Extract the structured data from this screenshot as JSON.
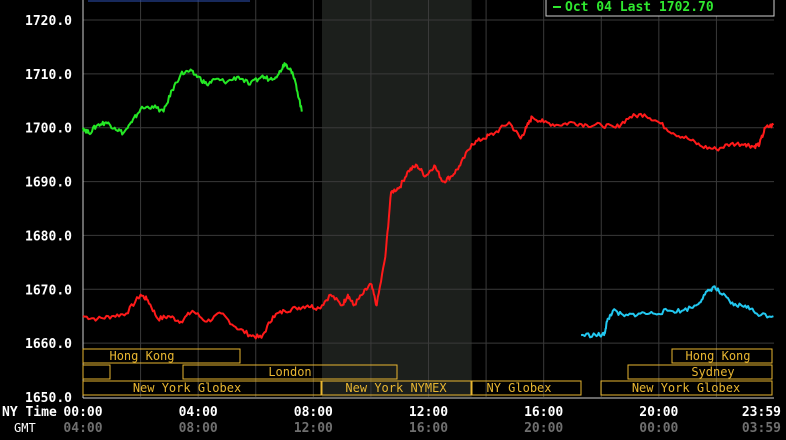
{
  "chart_data": {
    "type": "line",
    "legend": "Oct 04 Last 1702.70",
    "ylim": [
      1650,
      1720
    ],
    "yticks": [
      "1650.0",
      "1660.0",
      "1670.0",
      "1680.0",
      "1690.0",
      "1700.0",
      "1710.0",
      "1720.0"
    ],
    "x_ny_label": "NY Time",
    "x_gmt_label": "GMT",
    "xticks_ny": [
      "00:00",
      "04:00",
      "08:00",
      "12:00",
      "16:00",
      "20:00",
      "23:59"
    ],
    "xticks_gmt": [
      "04:00",
      "08:00",
      "12:00",
      "16:00",
      "20:00",
      "00:00",
      "03:59"
    ],
    "xtick_hours": [
      0,
      4,
      8,
      12,
      16,
      20,
      23.98
    ],
    "shaded_hours": [
      8.3,
      13.5
    ],
    "sessions": {
      "row1": [
        "Hong Kong",
        "Hong Kong"
      ],
      "row2": [
        "London",
        "Sydney"
      ],
      "row3": [
        "New York Globex",
        "New York NYMEX",
        "NY Globex",
        "New York Globex"
      ]
    },
    "series": [
      {
        "color": "#ff1a1a",
        "x": [
          0,
          0.5,
          1,
          1.5,
          2,
          2.25,
          2.6,
          3,
          3.4,
          3.8,
          4.3,
          4.8,
          5.3,
          5.8,
          6.2,
          6.6,
          7,
          7.4,
          7.8,
          8.2,
          8.6,
          9,
          9.2,
          9.4,
          9.7,
          10,
          10.2,
          10.5,
          10.7,
          11,
          11.3,
          11.6,
          11.9,
          12.2,
          12.5,
          12.8,
          13.1,
          13.5,
          13.9,
          14.3,
          14.8,
          15.2,
          15.4,
          15.6,
          16,
          16.5,
          17,
          17.5,
          18,
          18.5,
          19,
          19.5,
          20,
          20.5,
          21,
          21.5,
          22,
          22.5,
          23,
          23.3,
          23.5,
          23.7,
          23.98
        ],
        "y": [
          1665,
          1664.5,
          1665,
          1665.5,
          1669,
          1668,
          1664.5,
          1665,
          1664,
          1666,
          1664,
          1665.5,
          1663,
          1661.5,
          1661,
          1665,
          1666,
          1666.5,
          1667,
          1666.5,
          1669,
          1667,
          1669,
          1667,
          1669,
          1671,
          1667,
          1676,
          1688,
          1689,
          1692,
          1693,
          1691,
          1693,
          1690,
          1691,
          1693,
          1697,
          1698,
          1699,
          1701,
          1698,
          1700,
          1702,
          1701,
          1700.5,
          1701,
          1700.5,
          1700.5,
          1700,
          1702,
          1702.5,
          1701,
          1699,
          1698,
          1696.5,
          1696,
          1697,
          1697,
          1696.5,
          1697,
          1700,
          1700.5
        ]
      },
      {
        "color": "#25e825",
        "x": [
          0,
          0.2,
          0.5,
          0.8,
          1.1,
          1.4,
          1.7,
          2,
          2.4,
          2.8,
          3.1,
          3.4,
          3.7,
          4,
          4.3,
          4.6,
          5,
          5.4,
          5.8,
          6.2,
          6.5,
          6.8,
          7,
          7.2,
          7.4,
          7.6
        ],
        "y": [
          1700,
          1699,
          1700.5,
          1701,
          1700,
          1699,
          1701,
          1703.5,
          1704,
          1703,
          1707,
          1710,
          1710.5,
          1709.5,
          1708,
          1709,
          1708.5,
          1709.5,
          1708,
          1709.5,
          1709,
          1710,
          1712,
          1711,
          1708,
          1703
        ]
      },
      {
        "color": "#22c8f0",
        "x": [
          17.3,
          17.8,
          18.1,
          18.2,
          18.4,
          18.8,
          19.3,
          19.8,
          20.3,
          20.8,
          21.3,
          21.6,
          21.9,
          22.2,
          22.6,
          23,
          23.4,
          23.98
        ],
        "y": [
          1661.5,
          1661.5,
          1661.5,
          1664,
          1666,
          1665,
          1665.5,
          1665.5,
          1666,
          1666,
          1667,
          1669,
          1670.5,
          1669,
          1667,
          1667,
          1665.5,
          1665
        ]
      }
    ]
  }
}
